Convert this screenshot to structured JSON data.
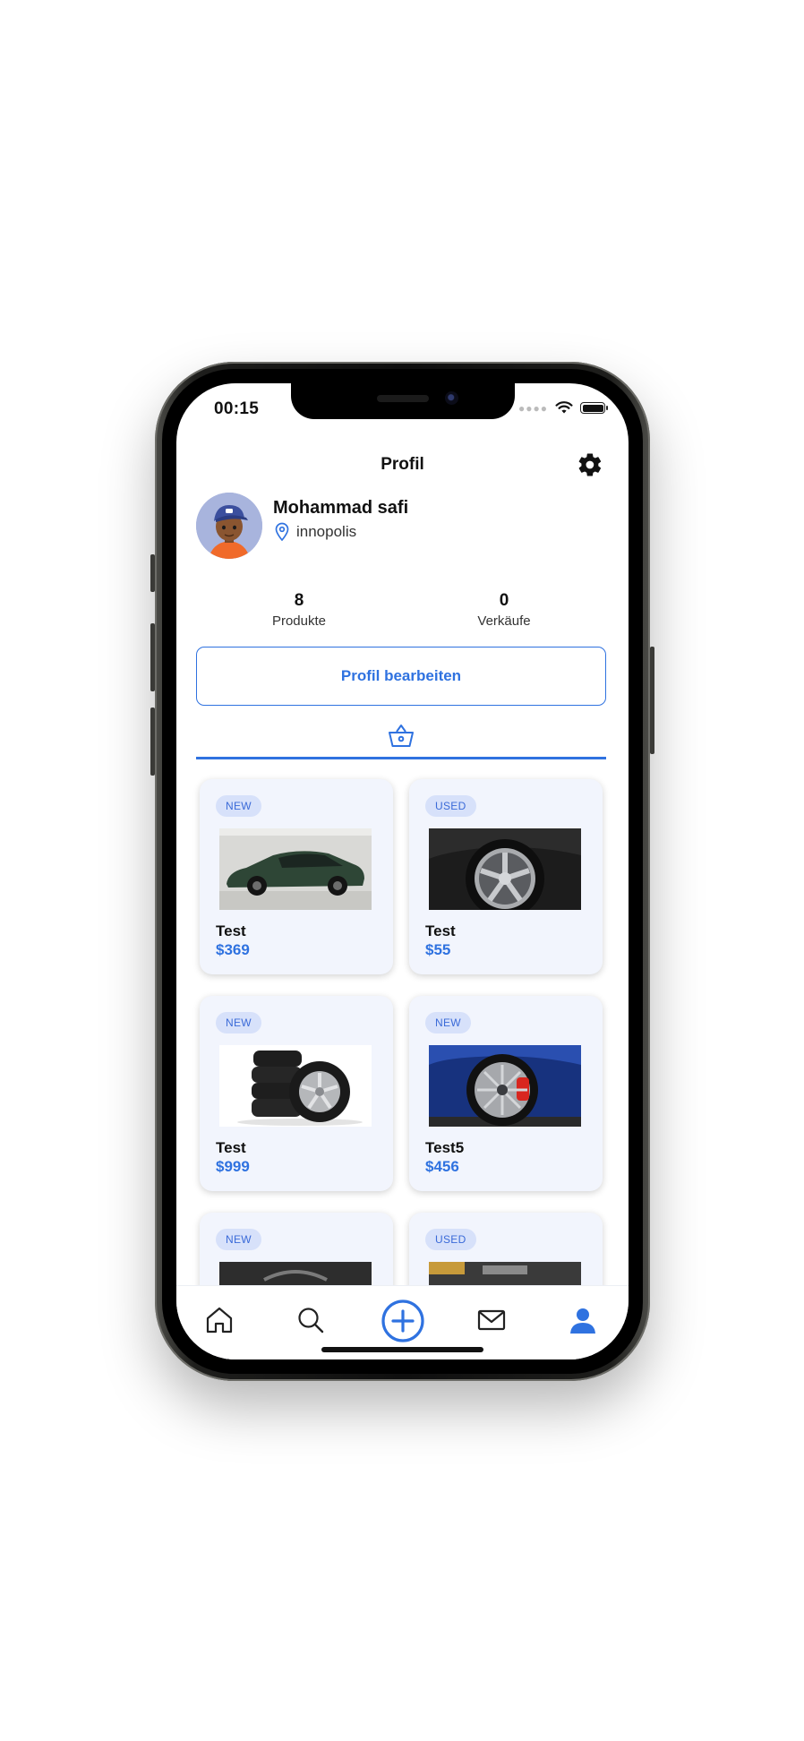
{
  "status_bar": {
    "time": "00:15"
  },
  "header": {
    "title": "Profil"
  },
  "profile": {
    "name": "Mohammad safi",
    "location": "innopolis"
  },
  "stats": [
    {
      "value": "8",
      "label": "Produkte"
    },
    {
      "value": "0",
      "label": "Verkäufe"
    }
  ],
  "edit_button": {
    "label": "Profil bearbeiten"
  },
  "products": [
    {
      "badge": "NEW",
      "title": "Test",
      "price": "$369",
      "image": "green-suv"
    },
    {
      "badge": "USED",
      "title": "Test",
      "price": "$55",
      "image": "alloy-wheel-black"
    },
    {
      "badge": "NEW",
      "title": "Test",
      "price": "$999",
      "image": "tire-stack"
    },
    {
      "badge": "NEW",
      "title": "Test5",
      "price": "$456",
      "image": "alloy-wheel-blue"
    },
    {
      "badge": "NEW",
      "title": "",
      "price": "",
      "image": "wheel-dark"
    },
    {
      "badge": "USED",
      "title": "",
      "price": "",
      "image": "engine-part"
    }
  ],
  "colors": {
    "accent": "#2f72e0",
    "badge_bg": "#d7e1fa",
    "card_bg": "#f2f5fd",
    "text": "#111111"
  },
  "bottom_nav": [
    {
      "icon": "home-icon",
      "active": false
    },
    {
      "icon": "search-icon",
      "active": false
    },
    {
      "icon": "plus-circle-icon",
      "active": false
    },
    {
      "icon": "mail-icon",
      "active": false
    },
    {
      "icon": "user-icon",
      "active": true
    }
  ]
}
